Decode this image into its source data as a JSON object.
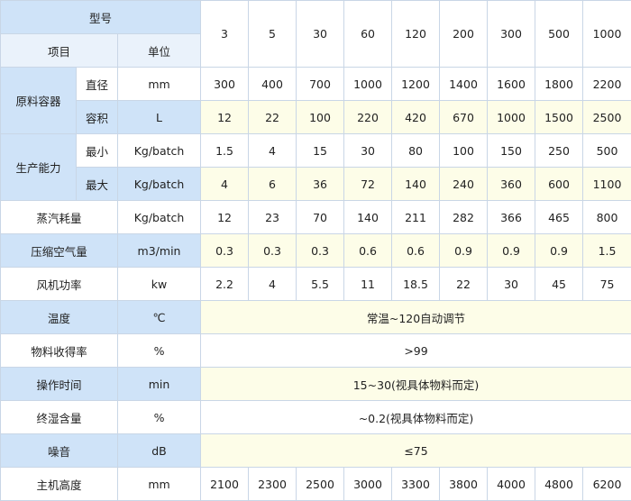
{
  "header": {
    "model_label": "型号",
    "item_label": "项目",
    "unit_label": "单位",
    "models": [
      "3",
      "5",
      "30",
      "60",
      "120",
      "200",
      "300",
      "500",
      "1000"
    ]
  },
  "groups": {
    "container": {
      "label": "原料容器",
      "rows": [
        {
          "sub": "直径",
          "unit": "mm",
          "values": [
            "300",
            "400",
            "700",
            "1000",
            "1200",
            "1400",
            "1600",
            "1800",
            "2200"
          ]
        },
        {
          "sub": "容积",
          "unit": "L",
          "values": [
            "12",
            "22",
            "100",
            "220",
            "420",
            "670",
            "1000",
            "1500",
            "2500"
          ]
        }
      ]
    },
    "capacity": {
      "label": "生产能力",
      "rows": [
        {
          "sub": "最小",
          "unit": "Kg/batch",
          "values": [
            "1.5",
            "4",
            "15",
            "30",
            "80",
            "100",
            "150",
            "250",
            "500"
          ]
        },
        {
          "sub": "最大",
          "unit": "Kg/batch",
          "values": [
            "4",
            "6",
            "36",
            "72",
            "140",
            "240",
            "360",
            "600",
            "1100"
          ]
        }
      ]
    }
  },
  "rows": {
    "steam": {
      "label": "蒸汽耗量",
      "unit": "Kg/batch",
      "values": [
        "12",
        "23",
        "70",
        "140",
        "211",
        "282",
        "366",
        "465",
        "800"
      ]
    },
    "air": {
      "label": "压缩空气量",
      "unit": "m3/min",
      "values": [
        "0.3",
        "0.3",
        "0.3",
        "0.6",
        "0.6",
        "0.9",
        "0.9",
        "0.9",
        "1.5"
      ]
    },
    "fan": {
      "label": "风机功率",
      "unit": "kw",
      "values": [
        "2.2",
        "4",
        "5.5",
        "11",
        "18.5",
        "22",
        "30",
        "45",
        "75"
      ]
    },
    "temperature": {
      "label": "温度",
      "unit": "℃",
      "value": "常温~120自动调节"
    },
    "yield": {
      "label": "物料收得率",
      "unit": "%",
      "value": ">99"
    },
    "time": {
      "label": "操作时间",
      "unit": "min",
      "value": "15~30(视具体物料而定)"
    },
    "moisture": {
      "label": "终湿含量",
      "unit": "%",
      "value": "~0.2(视具体物料而定)"
    },
    "noise": {
      "label": "噪音",
      "unit": "dB",
      "value": "≤75"
    },
    "height": {
      "label": "主机高度",
      "unit": "mm",
      "values": [
        "2100",
        "2300",
        "2500",
        "3000",
        "3300",
        "3800",
        "4000",
        "4800",
        "6200"
      ]
    }
  }
}
